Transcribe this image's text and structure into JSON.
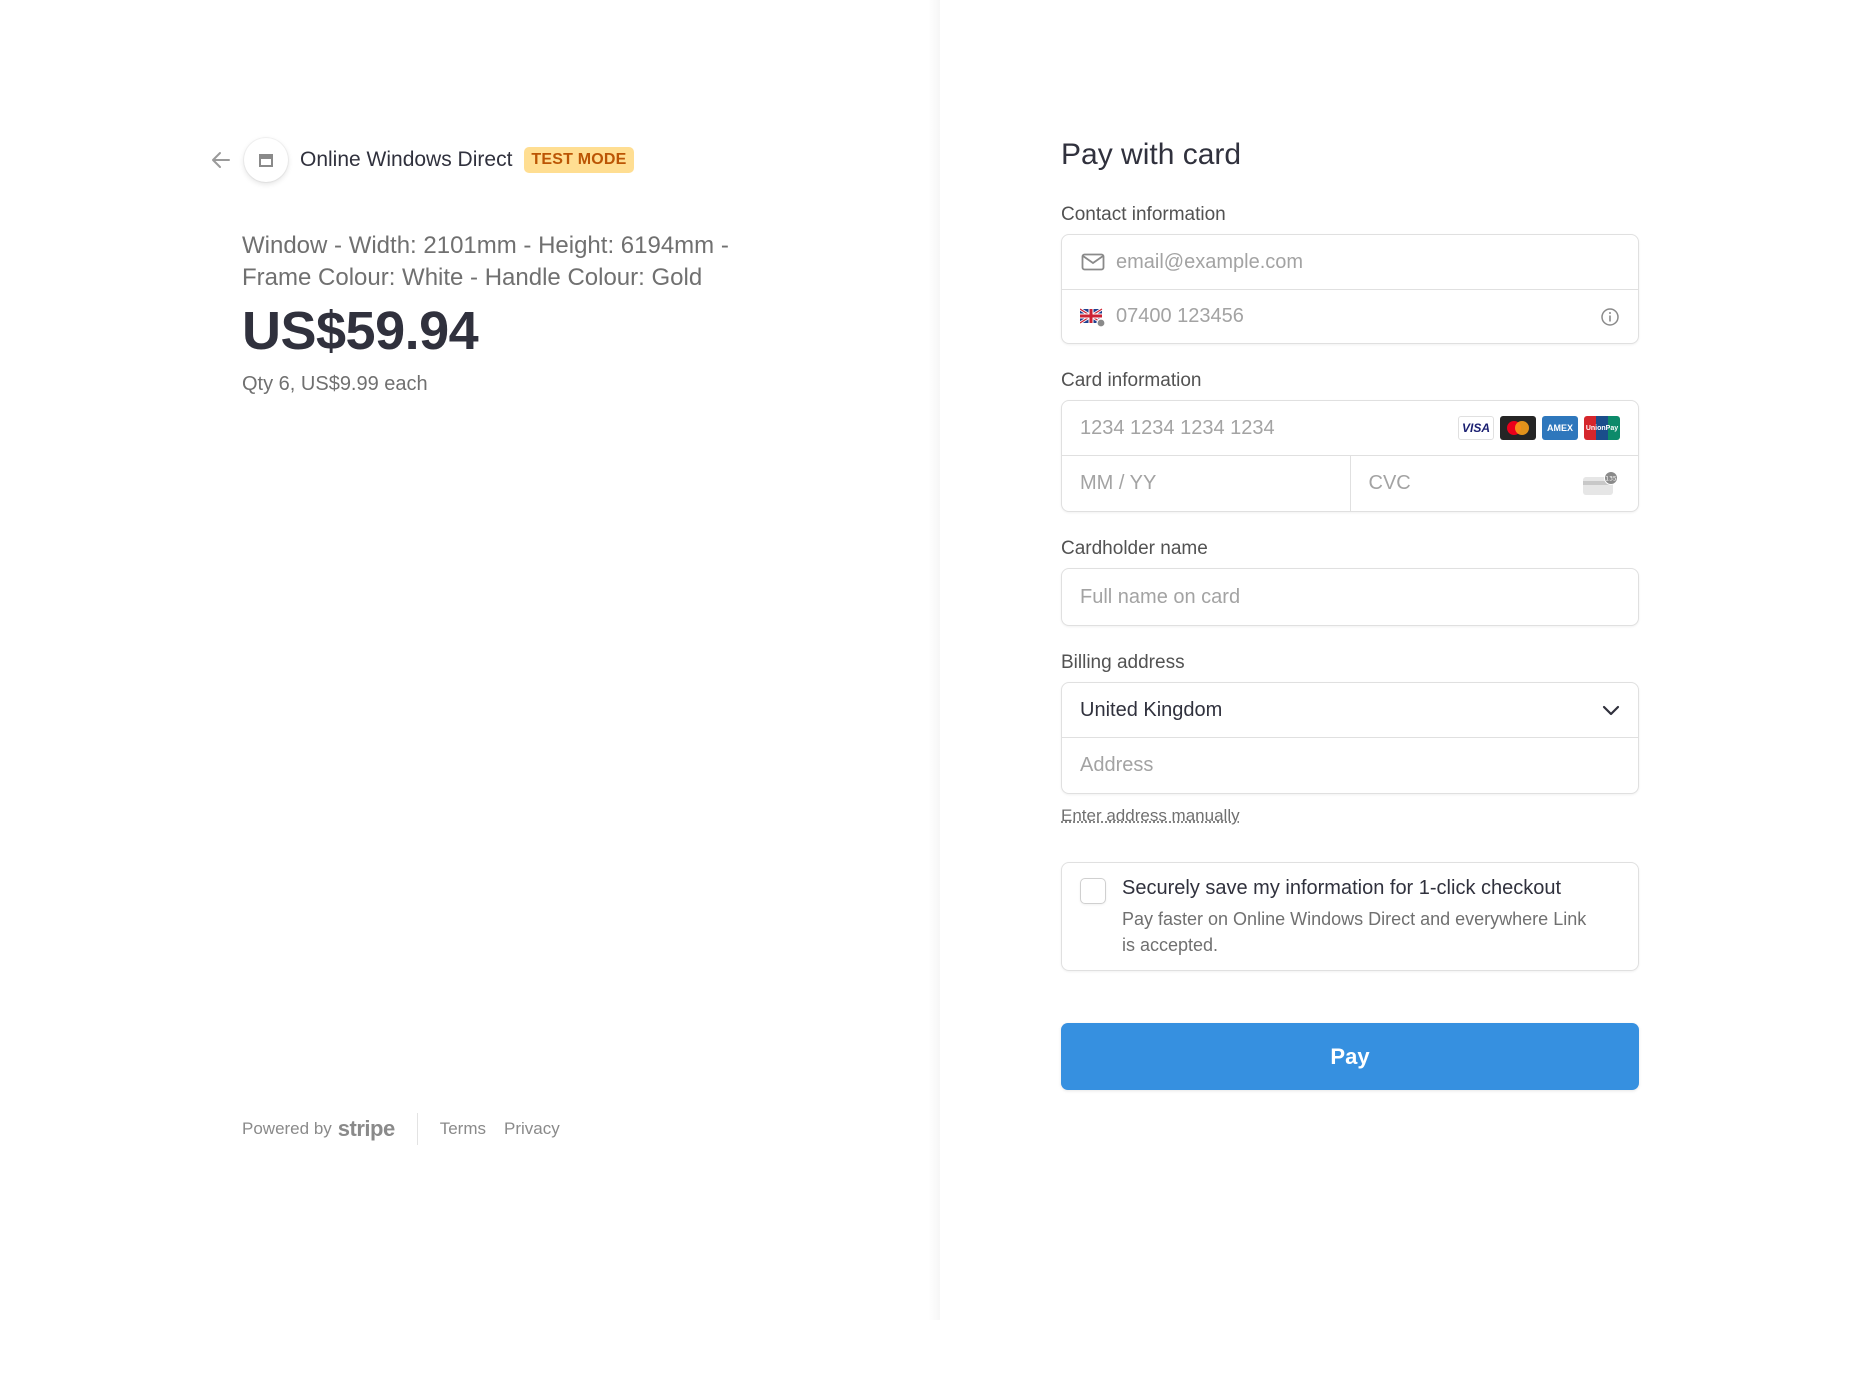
{
  "merchant": {
    "name": "Online Windows Direct",
    "mode_badge": "TEST MODE"
  },
  "product": {
    "description": "Window - Width: 2101mm - Height: 6194mm - Frame Colour: White - Handle Colour: Gold",
    "price": "US$59.94",
    "quantity_line": "Qty 6, US$9.99 each"
  },
  "footer": {
    "powered_by": "Powered by",
    "brand": "stripe",
    "terms": "Terms",
    "privacy": "Privacy"
  },
  "form": {
    "title": "Pay with card",
    "contact": {
      "label": "Contact information",
      "email_placeholder": "email@example.com",
      "phone_placeholder": "07400 123456"
    },
    "card": {
      "label": "Card information",
      "number_placeholder": "1234 1234 1234 1234",
      "expiry_placeholder": "MM / YY",
      "cvc_placeholder": "CVC",
      "brands": [
        "VISA",
        "mastercard",
        "AMEX",
        "UnionPay"
      ]
    },
    "cardholder": {
      "label": "Cardholder name",
      "placeholder": "Full name on card"
    },
    "billing": {
      "label": "Billing address",
      "country": "United Kingdom",
      "address_placeholder": "Address",
      "manual_link": "Enter address manually"
    },
    "save": {
      "title": "Securely save my information for 1-click checkout",
      "subtitle": "Pay faster on Online Windows Direct and everywhere Link is accepted.",
      "checked": false
    },
    "pay_button": "Pay"
  },
  "colors": {
    "accent": "#3690e0",
    "badge_bg": "#ffde92",
    "badge_text": "#bb5504"
  }
}
